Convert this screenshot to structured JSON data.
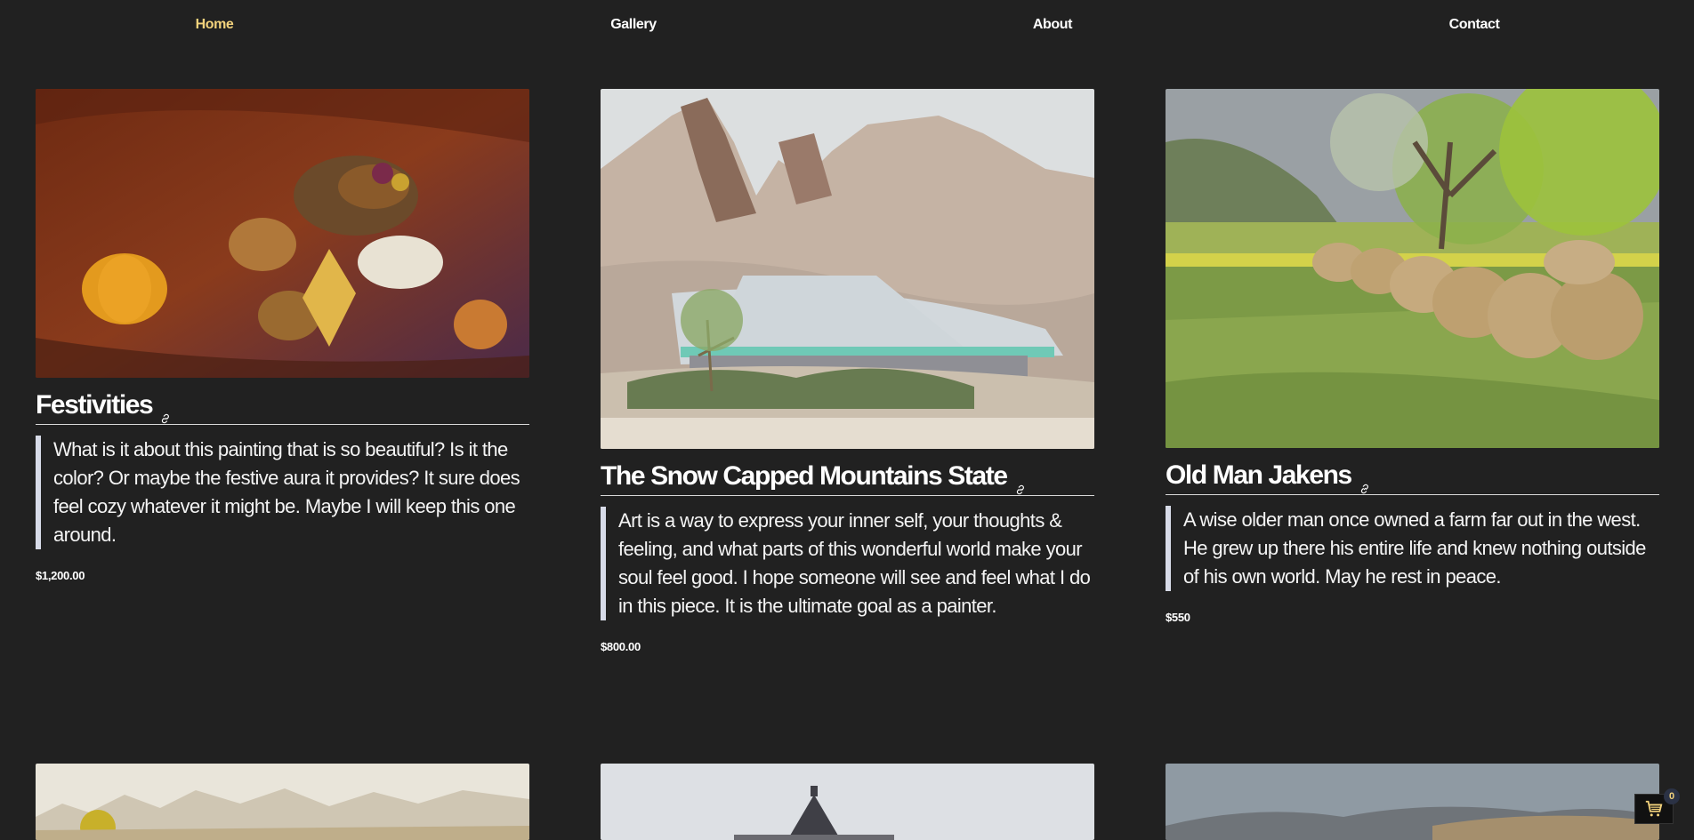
{
  "nav": {
    "home": "Home",
    "gallery": "Gallery",
    "about": "About",
    "contact": "Contact"
  },
  "colors": {
    "background": "#212121",
    "active_nav": "#f2d27c",
    "quote_bar": "#d7dbe8"
  },
  "paintings": [
    {
      "title": "Festivities",
      "description": "What is it about this painting that is so beautiful? Is it the color? Or maybe the festive aura it provides? It sure does feel cozy whatever it might be. Maybe I will keep this one around.",
      "price": "$1,200.00"
    },
    {
      "title": "The Snow Capped Mountains State",
      "description": "Art is a way to express your inner self, your thoughts & feeling, and what parts of this wonderful world make your soul feel good. I hope someone will see and feel what I do in this piece. It is the ultimate goal as a painter.",
      "price": "$800.00"
    },
    {
      "title": "Old Man Jakens",
      "description": "A wise older man once owned a farm far out in the west. He grew up there his entire life and knew nothing outside of his own world. May he rest in peace.",
      "price": "$550"
    }
  ],
  "cart": {
    "count": "0",
    "icon": "cart-icon"
  }
}
